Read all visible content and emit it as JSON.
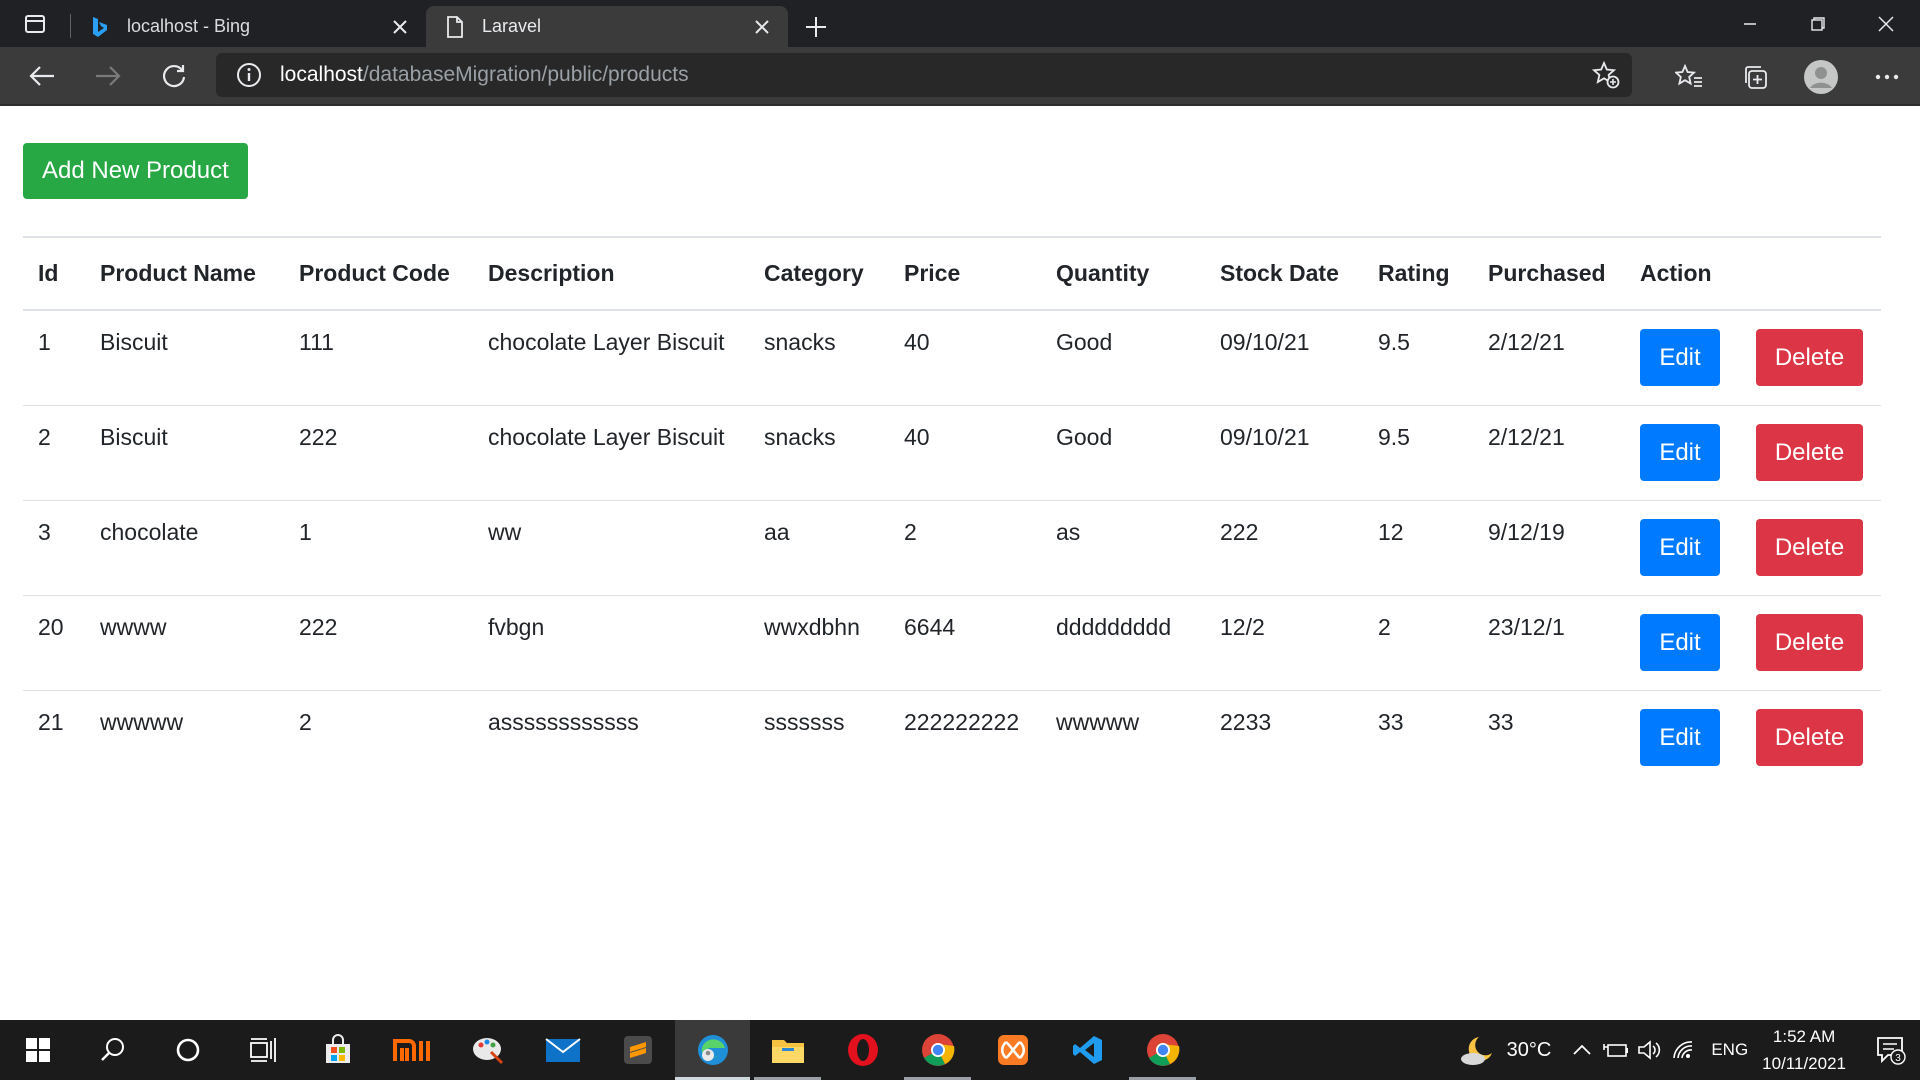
{
  "browser": {
    "tabs": [
      {
        "title": "localhost - Bing",
        "icon": "bing-icon"
      },
      {
        "title": "Laravel",
        "icon": "page-icon"
      }
    ],
    "url_host": "localhost",
    "url_path": "/databaseMigration/public/products"
  },
  "page": {
    "add_button": "Add New Product",
    "columns": [
      "Id",
      "Product Name",
      "Product Code",
      "Description",
      "Category",
      "Price",
      "Quantity",
      "Stock Date",
      "Rating",
      "Purchased",
      "Action"
    ],
    "rows": [
      [
        "1",
        "Biscuit",
        "111",
        "chocolate Layer Biscuit",
        "snacks",
        "40",
        "Good",
        "09/10/21",
        "9.5",
        "2/12/21"
      ],
      [
        "2",
        "Biscuit",
        "222",
        "chocolate Layer Biscuit",
        "snacks",
        "40",
        "Good",
        "09/10/21",
        "9.5",
        "2/12/21"
      ],
      [
        "3",
        "chocolate",
        "1",
        "ww",
        "aa",
        "2",
        "as",
        "222",
        "12",
        "9/12/19"
      ],
      [
        "20",
        "wwww",
        "222",
        "fvbgn",
        "wwxdbhn",
        "6644",
        "ddddddddd",
        "12/2",
        "2",
        "23/12/1"
      ],
      [
        "21",
        "wwwww",
        "2",
        "assssssssssss",
        "sssssss",
        "222222222",
        "wwwww",
        "2233",
        "33",
        "33"
      ]
    ],
    "edit_label": "Edit",
    "delete_label": "Delete",
    "colors": {
      "add": "#28a745",
      "edit": "#007bff",
      "delete": "#dc3545"
    }
  },
  "taskbar": {
    "temperature": "30°C",
    "language": "ENG",
    "time": "1:52 AM",
    "date": "10/11/2021",
    "notifications": "3"
  }
}
